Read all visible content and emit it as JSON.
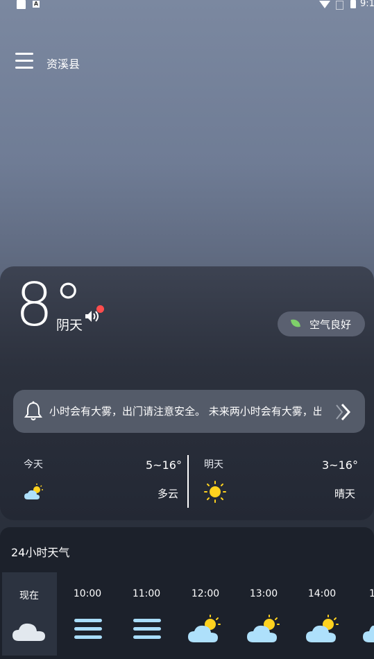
{
  "status_bar": {
    "time": "9:1",
    "icons": [
      "square-icon",
      "a-icon",
      "wifi-icon",
      "no-sim-icon",
      "battery-icon"
    ]
  },
  "header": {
    "city": "资溪县",
    "menu_icon": "hamburger-icon"
  },
  "current": {
    "temperature": "8°",
    "condition": "阴天",
    "speaker_icon": "speaker-icon",
    "air_quality": "空气良好"
  },
  "alert": {
    "text": "小时会有大雾，出门请注意安全。  未来两小时会有大雾，出门"
  },
  "forecast": [
    {
      "day": "今天",
      "range": "5~16°",
      "condition": "多云",
      "icon": "partly-cloudy-icon"
    },
    {
      "day": "明天",
      "range": "3~16°",
      "condition": "晴天",
      "icon": "sunny-icon"
    }
  ],
  "hourly": {
    "title": "24小时天气",
    "hours": [
      {
        "time": "现在",
        "icon": "cloudy-icon"
      },
      {
        "time": "10:00",
        "icon": "fog-icon"
      },
      {
        "time": "11:00",
        "icon": "fog-icon"
      },
      {
        "time": "12:00",
        "icon": "partly-cloudy-icon"
      },
      {
        "time": "13:00",
        "icon": "partly-cloudy-icon"
      },
      {
        "time": "14:00",
        "icon": "partly-cloudy-icon"
      },
      {
        "time": "1",
        "icon": "partly-cloudy-icon"
      }
    ]
  }
}
